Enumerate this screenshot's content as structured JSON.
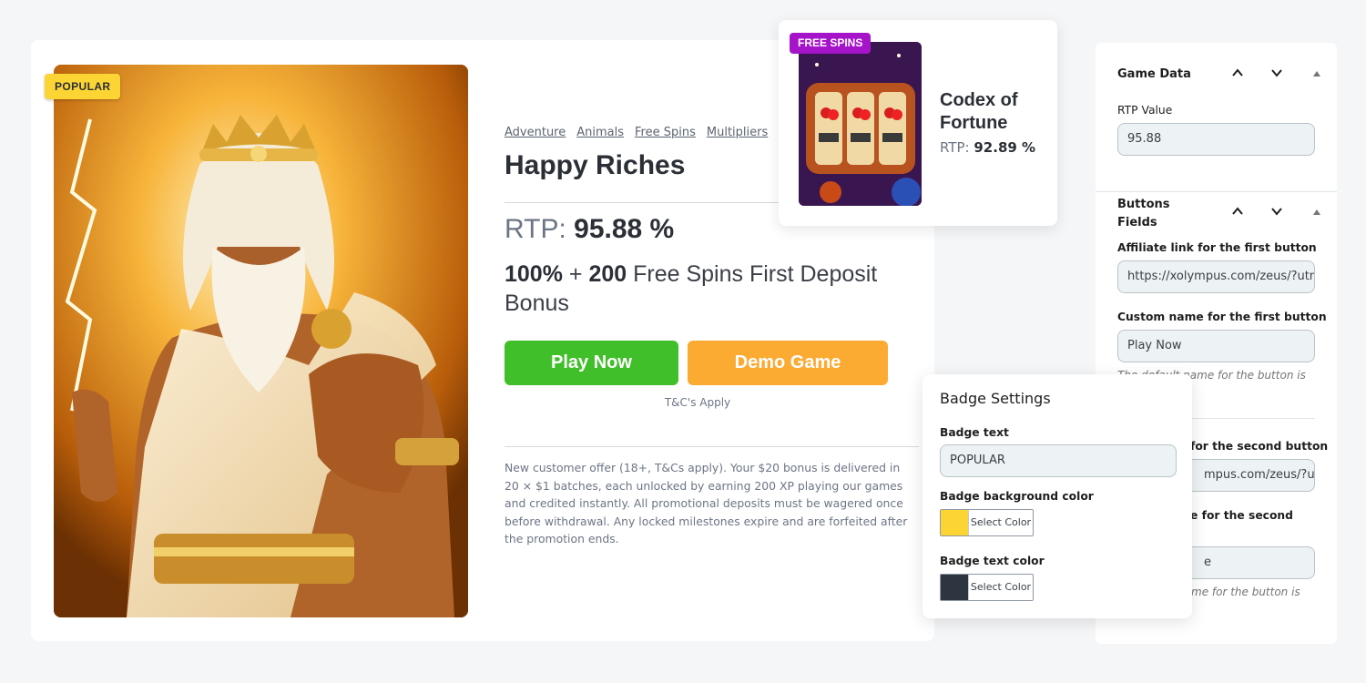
{
  "game_card": {
    "badge": "POPULAR",
    "tags": [
      "Adventure",
      "Animals",
      "Free Spins",
      "Multipliers"
    ],
    "title": "Happy Riches",
    "rtp_label": "RTP:",
    "rtp_value": "95.88 %",
    "bonus_bold1": "100%",
    "bonus_plus": " + ",
    "bonus_bold2": "200",
    "bonus_rest": " Free Spins First Deposit Bonus",
    "play_button": "Play Now",
    "demo_button": "Demo Game",
    "tc": "T&C's Apply",
    "disclaimer": "New customer offer (18+, T&Cs apply). Your $20 bonus is delivered in 20 × $1 batches, each unlocked by earning 200 XP playing our games and credited instantly. All promotional deposits must be wagered once before withdrawal. Any locked milestones expire and are forfeited after the promotion ends.",
    "image_icon": "zeus-illustration"
  },
  "codex_card": {
    "badge": "FREE SPINS",
    "title": "Codex of Fortune",
    "rtp_label": "RTP:",
    "rtp_value": "92.89 %",
    "image_icon": "slot-machine-illustration"
  },
  "settings_panel": {
    "game_data": {
      "heading": "Game Data",
      "rtp_label": "RTP Value",
      "rtp_value": "95.88"
    },
    "buttons_fields": {
      "heading_line1": "Buttons",
      "heading_line2": "Fields",
      "aff1_label": "Affiliate link for the first button",
      "aff1_value": "https://xolympus.com/zeus/?utm",
      "name1_label": "Custom name for the first button",
      "name1_value": "Play Now",
      "name1_help": "The default name for the button is",
      "aff2_label_visible": "for the second button",
      "aff2_value_visible": "mpus.com/zeus/?utr",
      "name2_label_visible": "e for the second",
      "name2_value_visible": "e",
      "name2_help_visible": "me for the button is"
    }
  },
  "badge_settings": {
    "title": "Badge Settings",
    "text_label": "Badge text",
    "text_value": "POPULAR",
    "bg_label": "Badge background color",
    "bg_color": "#fcd535",
    "bg_button": "Select Color",
    "fg_label": "Badge text color",
    "fg_color": "#2d3540",
    "fg_button": "Select Color"
  },
  "colors": {
    "play": "#41bf2b",
    "demo": "#fbaa32",
    "free_spins_badge": "#a514c9"
  }
}
